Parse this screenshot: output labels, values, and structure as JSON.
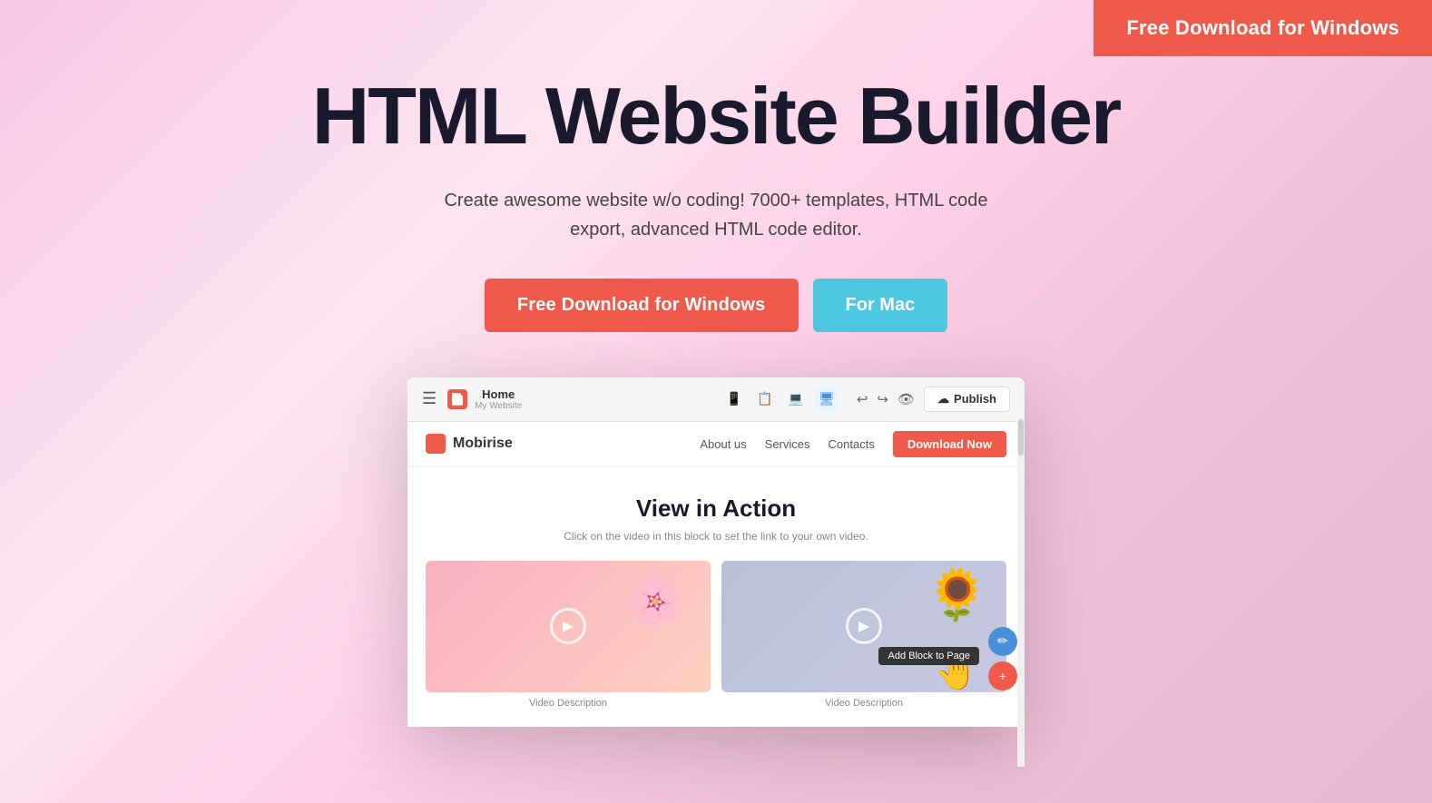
{
  "topCta": {
    "label": "Free Download for Windows",
    "bg": "#f05a4a"
  },
  "hero": {
    "title": "HTML Website Builder",
    "subtitle": "Create awesome website w/o coding! 7000+ templates, HTML code export, advanced HTML code editor.",
    "btnWindows": "Free Download for Windows",
    "btnMac": "For Mac"
  },
  "appPreview": {
    "toolbar": {
      "pageName": "Home",
      "pageSubtitle": "My Website",
      "publishLabel": "Publish"
    },
    "navbar": {
      "logoText": "Mobirise",
      "links": [
        "About us",
        "Services",
        "Contacts"
      ],
      "downloadBtn": "Download Now"
    },
    "content": {
      "sectionTitle": "View in Action",
      "sectionSubtitle": "Click on the video in this block to set the link to your own video.",
      "video1Desc": "Video Description",
      "video2Desc": "Video Description",
      "addBlockLabel": "Add Block to Page"
    }
  }
}
